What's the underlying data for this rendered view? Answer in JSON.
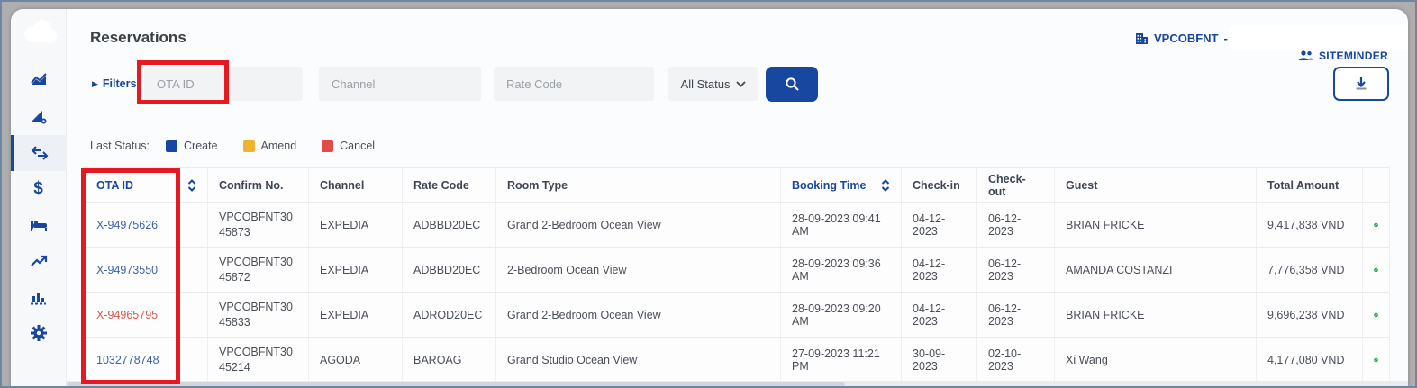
{
  "app": {
    "title": "Reservations",
    "property_code": "VPCOBFNT",
    "property_separator": "-",
    "brand": "SITEMINDER"
  },
  "icons": {
    "logo": "cloud-logo",
    "property": "building-icon",
    "brand": "people-icon",
    "download": "download-icon",
    "search": "search-icon",
    "sidebar": [
      "area-chart-icon",
      "flag-chart-icon",
      "swap-arrows-icon",
      "dollar-icon",
      "bed-icon",
      "trend-line-icon",
      "bar-chart-icon",
      "gear-icon"
    ],
    "sidebar_active_index": 2,
    "row_status_icon": "check-circle-green"
  },
  "filters": {
    "label": "Filters",
    "ota_id_placeholder": "OTA ID",
    "channel_placeholder": "Channel",
    "rate_code_placeholder": "Rate Code",
    "status_selected": "All Status"
  },
  "legend": {
    "label": "Last Status:",
    "items": [
      {
        "label": "Create",
        "color": "#17479e"
      },
      {
        "label": "Amend",
        "color": "#f0b32e"
      },
      {
        "label": "Cancel",
        "color": "#e34b4b"
      }
    ]
  },
  "table": {
    "columns": [
      "OTA ID",
      "Confirm No.",
      "Channel",
      "Rate Code",
      "Room Type",
      "Booking Time",
      "Check-in",
      "Check-out",
      "Guest",
      "Total Amount",
      ""
    ],
    "sorted_columns": [
      "OTA ID",
      "Booking Time"
    ],
    "rows": [
      {
        "ota_id": "X-94975626",
        "last_status": "create",
        "confirm_no": "VPCOBFNT3045873",
        "channel": "EXPEDIA",
        "rate_code": "ADBBD20EC",
        "room_type": "Grand 2-Bedroom Ocean View",
        "booking_time": "28-09-2023 09:41 AM",
        "check_in": "04-12-2023",
        "check_out": "06-12-2023",
        "guest": "BRIAN FRICKE",
        "total_amount": "9,417,838 VND"
      },
      {
        "ota_id": "X-94973550",
        "last_status": "create",
        "confirm_no": "VPCOBFNT3045872",
        "channel": "EXPEDIA",
        "rate_code": "ADBBD20EC",
        "room_type": "2-Bedroom Ocean View",
        "booking_time": "28-09-2023 09:36 AM",
        "check_in": "04-12-2023",
        "check_out": "06-12-2023",
        "guest": "AMANDA COSTANZI",
        "total_amount": "7,776,358 VND"
      },
      {
        "ota_id": "X-94965795",
        "last_status": "cancel",
        "confirm_no": "VPCOBFNT3045833",
        "channel": "EXPEDIA",
        "rate_code": "ADROD20EC",
        "room_type": "Grand 2-Bedroom Ocean View",
        "booking_time": "28-09-2023 09:20 AM",
        "check_in": "04-12-2023",
        "check_out": "06-12-2023",
        "guest": "BRIAN FRICKE",
        "total_amount": "9,696,238 VND"
      },
      {
        "ota_id": "1032778748",
        "last_status": "create",
        "confirm_no": "VPCOBFNT3045214",
        "channel": "AGODA",
        "rate_code": "BAROAG",
        "room_type": "Grand Studio Ocean View",
        "booking_time": "27-09-2023 11:21 PM",
        "check_in": "30-09-2023",
        "check_out": "02-10-2023",
        "guest": "Xi Wang",
        "total_amount": "4,177,080 VND"
      }
    ]
  },
  "colors": {
    "accent_navy": "#17479e",
    "link_blue": "#3c63a8",
    "cancel_red": "#df544d",
    "success_green": "#34a853",
    "annotation_red": "#e5191f",
    "input_gray": "#f1f3f4"
  }
}
